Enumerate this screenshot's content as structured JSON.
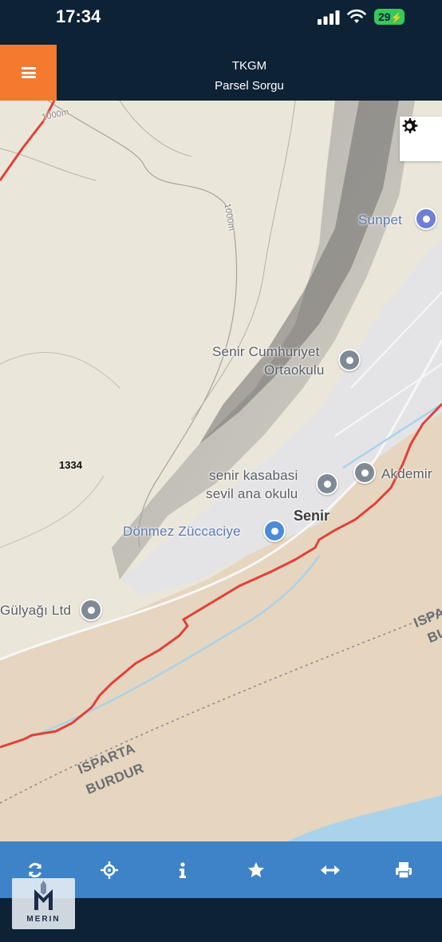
{
  "status_bar": {
    "time": "17:34",
    "battery": "29"
  },
  "header": {
    "title": "TKGM",
    "subtitle": "Parsel Sorgu"
  },
  "map": {
    "contour_labels": [
      "1000m",
      "1000m"
    ],
    "parcel_number": "1334",
    "pois": [
      {
        "name": "Sunpet",
        "icon": "fuel-icon"
      },
      {
        "name": "Senir Cumhuriyet",
        "name2": "Ortaokulu",
        "icon": "school-icon"
      },
      {
        "name": "senir kasabasi",
        "name2": "sevil ana okulu",
        "icon": "school-icon"
      },
      {
        "name": "Akdemir",
        "icon": "pin-icon"
      },
      {
        "name": "Dönmez Züccaciye",
        "icon": "shopping-bag-icon"
      },
      {
        "name": "Gülyağı Ltd",
        "icon": "pin-icon"
      }
    ],
    "place_name": "Senir",
    "boundary_labels": {
      "line1": "ISPARTA",
      "line2": "BURDUR",
      "right1": "ISPA",
      "right2": "BU"
    },
    "colors": {
      "parcel_boundary": "#e0413a",
      "water": "#a9d3ea",
      "road": "#ffffff"
    }
  },
  "toolbar": {
    "items": [
      {
        "name": "refresh-icon"
      },
      {
        "name": "locate-icon"
      },
      {
        "name": "info-icon"
      },
      {
        "name": "favorite-icon"
      },
      {
        "name": "measure-icon"
      },
      {
        "name": "print-icon"
      }
    ]
  },
  "logo": {
    "text": "MERIN"
  }
}
